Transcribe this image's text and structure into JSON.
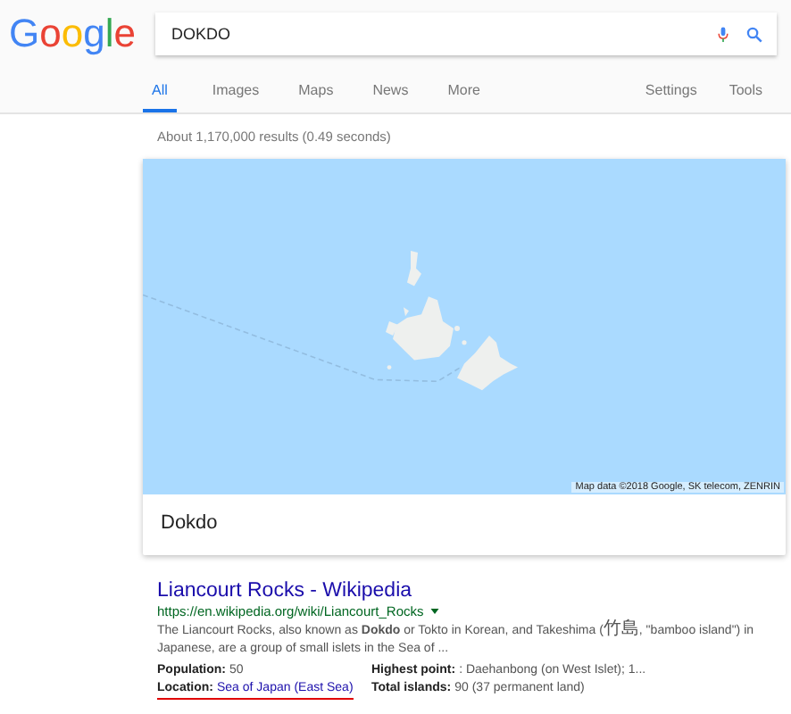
{
  "logo": [
    {
      "char": "G",
      "color": "#4285f4"
    },
    {
      "char": "o",
      "color": "#ea4335"
    },
    {
      "char": "o",
      "color": "#fbbc05"
    },
    {
      "char": "g",
      "color": "#4285f4"
    },
    {
      "char": "l",
      "color": "#34a853"
    },
    {
      "char": "e",
      "color": "#ea4335"
    }
  ],
  "search": {
    "value": "DOKDO"
  },
  "tabs": [
    {
      "label": "All",
      "selected": true
    },
    {
      "label": "Images",
      "selected": false
    },
    {
      "label": "Maps",
      "selected": false
    },
    {
      "label": "News",
      "selected": false
    },
    {
      "label": "More",
      "selected": false
    }
  ],
  "tools": [
    "Settings",
    "Tools"
  ],
  "result_stats": "About 1,170,000 results (0.49 seconds)",
  "map_card": {
    "attribution": "Map data ©2018 Google, SK telecom, ZENRIN",
    "title": "Dokdo"
  },
  "result": {
    "title": "Liancourt Rocks - Wikipedia",
    "url": "https://en.wikipedia.org/wiki/Liancourt_Rocks",
    "snippet": [
      {
        "text": "The Liancourt Rocks, also known as **Dokdo** or Tokto in Korean, and Takeshima (",
        "kind": "latin"
      },
      {
        "text": "竹島",
        "kind": "cjk"
      },
      {
        "text": ", \"bamboo island\") in Japanese, are a group of small islets in the Sea of ...",
        "kind": "latin"
      }
    ],
    "facts": [
      {
        "label": "Population:",
        "value": "50",
        "link": false,
        "underlined": false
      },
      {
        "label": "Highest point:",
        "value": ": Daehanbong (on West Islet); 1...",
        "link": false,
        "underlined": false
      },
      {
        "label": "Location:",
        "value": "Sea of Japan (East Sea)",
        "link": true,
        "underlined": true
      },
      {
        "label": "Total islands:",
        "value": "90 (37 permanent land)",
        "link": false,
        "underlined": false
      }
    ]
  }
}
